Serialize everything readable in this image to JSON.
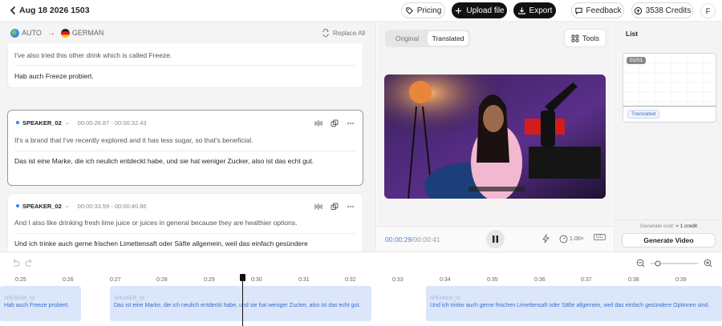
{
  "header": {
    "title": "Aug 18 2026 1503",
    "pricing": "Pricing",
    "upload": "Upload file",
    "export": "Export",
    "feedback": "Feedback",
    "credits": "3538 Credits",
    "avatar": "F"
  },
  "langbar": {
    "source": "AUTO",
    "target": "GERMAN",
    "replace_all": "Replace All"
  },
  "segments": [
    {
      "source": "I've also tried this other drink which is called Freeze.",
      "target": "Hab auch Freeze probiert."
    },
    {
      "speaker": "SPEAKER_02",
      "time": "00:00:26.87 - 00:00:32.43",
      "source": "It's a brand that I've recently explored and it has less sugar, so that's beneficial.",
      "target": "Das ist eine Marke, die ich neulich entdeckt habe, und sie hat weniger Zucker, also ist das echt gut."
    },
    {
      "speaker": "SPEAKER_02",
      "time": "00:00:33.59 - 00:00:40.86",
      "source": "And I also like drinking fresh lime juice or juices in general because they are healthier options.",
      "target": "Und ich trinke auch gerne frischen Limettensaft oder Säfte allgemein, weil das einfach gesündere"
    }
  ],
  "preview": {
    "tab_original": "Original",
    "tab_translated": "Translated",
    "tools": "Tools",
    "time_current": "00:00:29",
    "time_total": "/00:00:41",
    "speed": "1.00×",
    "cc": "CC"
  },
  "list": {
    "title": "List",
    "index": "01/01",
    "badge": "Translated",
    "cost_label": "Generate cost:",
    "cost_value": "≈ 1 credit",
    "generate": "Generate Video"
  },
  "timeline": {
    "ticks": [
      "0:25",
      "0:26",
      "0:27",
      "0:28",
      "0:29",
      "0:30",
      "0:31",
      "0:32",
      "0:33",
      "0:34",
      "0:35",
      "0:36",
      "0:37",
      "0:38",
      "0:39"
    ],
    "clips": [
      {
        "speaker": "SPEAKER_02",
        "text": "Hab auch Freeze probiert."
      },
      {
        "speaker": "SPEAKER_02",
        "text": "Das ist eine Marke, die ich neulich entdeckt habe, und sie hat weniger Zucker, also ist das echt gut."
      },
      {
        "speaker": "SPEAKER_02",
        "text": "Und ich trinke auch gerne frischen Limettensaft oder Säfte allgemein, weil das einfach gesündere Optionen sind."
      }
    ]
  },
  "colors": {
    "accent": "#3b82f6",
    "clip": "#dbe6fa",
    "dark_button": "#111111"
  }
}
